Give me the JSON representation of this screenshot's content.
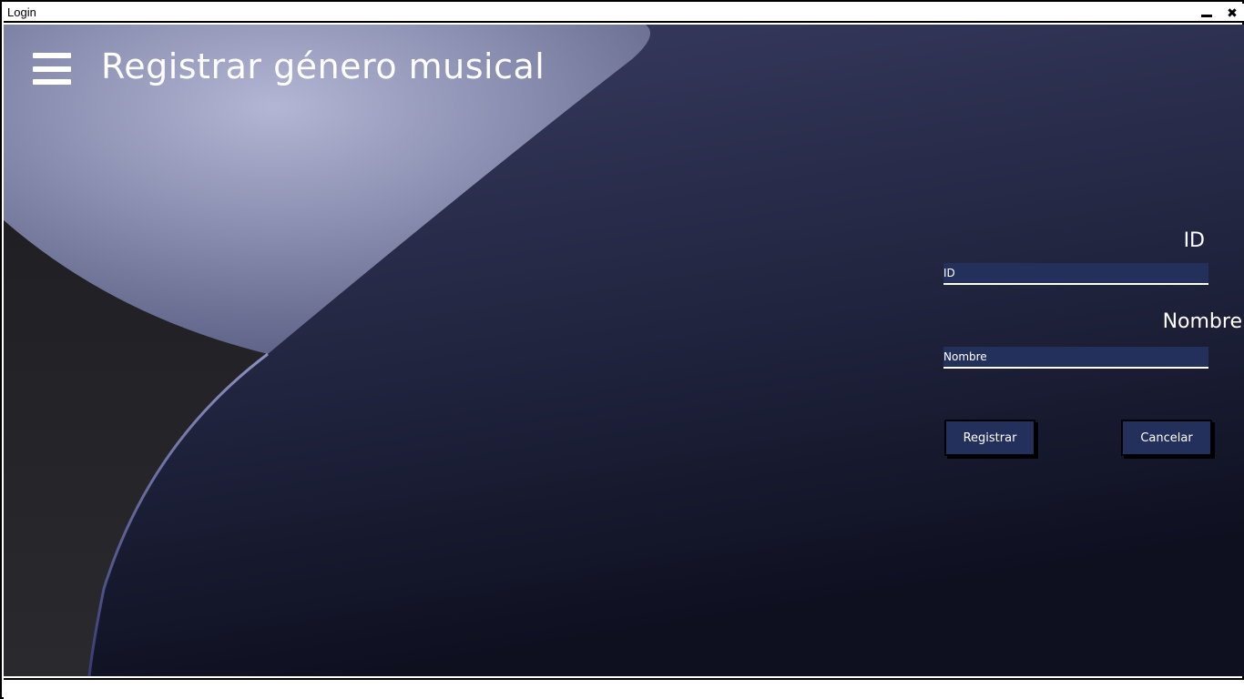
{
  "window": {
    "title": "Login",
    "minimize_icon": "minimize-icon",
    "close_icon": "close-icon",
    "close_glyph": "✖"
  },
  "header": {
    "menu_icon": "hamburger-menu-icon",
    "title": "Registrar género musical"
  },
  "form": {
    "id_label": "ID",
    "id_placeholder": "ID",
    "id_value": "",
    "nombre_label": "Nombre",
    "nombre_placeholder": "Nombre",
    "nombre_value": "",
    "register_label": "Registrar",
    "cancel_label": "Cancelar"
  },
  "colors": {
    "background_dark": "#1e2036",
    "input_fill": "#23305c",
    "button_fill": "#23305c",
    "text": "#ffffff"
  }
}
